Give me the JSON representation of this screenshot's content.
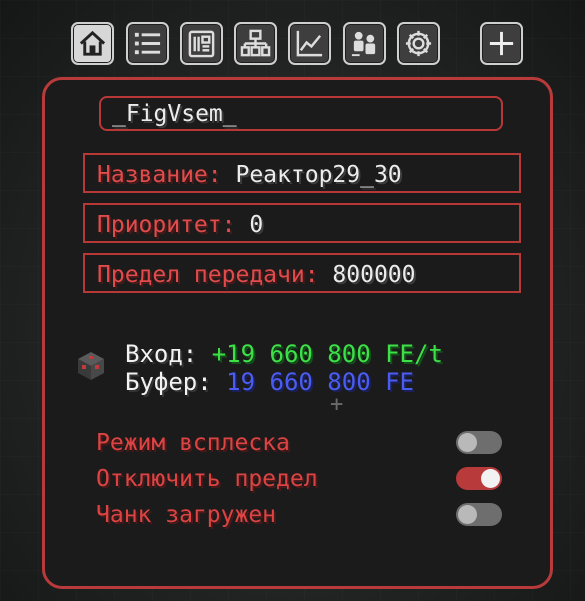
{
  "toolbar": {
    "buttons": [
      {
        "icon": "home-icon",
        "active": true
      },
      {
        "icon": "list-icon",
        "active": false
      },
      {
        "icon": "device-info-icon",
        "active": false
      },
      {
        "icon": "network-tree-icon",
        "active": false
      },
      {
        "icon": "chart-icon",
        "active": false
      },
      {
        "icon": "users-transfer-icon",
        "active": false
      },
      {
        "icon": "gear-icon",
        "active": false
      },
      {
        "icon": "plus-icon",
        "active": false
      }
    ]
  },
  "panel": {
    "network_name": "_FigVsem_",
    "fields": {
      "name": {
        "label": "Название:",
        "value": "Реактор29_30"
      },
      "priority": {
        "label": "Приоритет:",
        "value": "0"
      },
      "transfer_limit": {
        "label": "Предел передачи:",
        "value": "800000"
      }
    },
    "stats": {
      "input_label": "Вход:",
      "input_value": "+19 660 800 FE/t",
      "buffer_label": "Буфер:",
      "buffer_value": "19 660 800 FE"
    },
    "toggles": [
      {
        "label": "Режим всплеска",
        "on": false
      },
      {
        "label": "Отключить предел",
        "on": true
      },
      {
        "label": "Чанк загружен",
        "on": false
      }
    ]
  },
  "colors": {
    "accent_red": "#b93a3a",
    "label_red": "#e24b4b",
    "input_green": "#3ee048",
    "buffer_blue": "#4b5cf0",
    "panel_bg": "#1b1b1b"
  }
}
